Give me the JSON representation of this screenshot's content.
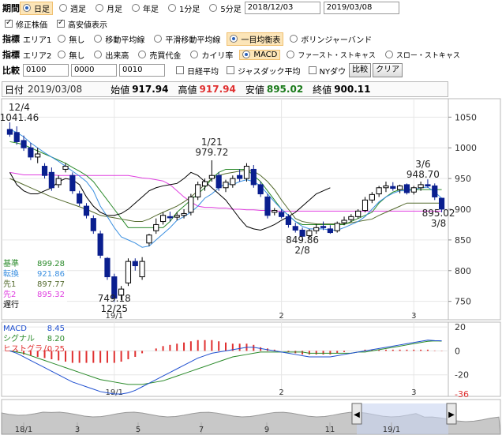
{
  "toolbar": {
    "period": {
      "label": "期間",
      "options": [
        "日足",
        "週足",
        "月足",
        "年足",
        "1分足",
        "5分足"
      ],
      "selected": "日足",
      "date_from": "2018/12/03",
      "date_to": "2019/03/08"
    },
    "checks": [
      {
        "label": "修正株価",
        "checked": true
      },
      {
        "label": "高安値表示",
        "checked": true
      }
    ],
    "indicator1": {
      "label": "指標",
      "sub": "エリア1",
      "options": [
        "無し",
        "移動平均線",
        "平滑移動平均線",
        "一目均衡表",
        "ボリンジャーバンド"
      ],
      "selected": "一目均衡表"
    },
    "indicator2": {
      "label": "指標",
      "sub": "エリア2",
      "options": [
        "無し",
        "出来高",
        "売買代金",
        "カイリ率",
        "MACD",
        "ファースト・ストキャス",
        "スロー・ストキャス"
      ],
      "selected": "MACD"
    },
    "compare": {
      "label": "比較",
      "inputs": [
        "0100",
        "0000",
        "0010"
      ],
      "checks": [
        "日経平均",
        "ジャスダック平均",
        "NYダウ"
      ],
      "compare_button": "比較",
      "clear_button": "クリア"
    }
  },
  "info_bar": {
    "date_label": "日付",
    "date": "2019/03/08",
    "open_label": "始値",
    "open": "917.94",
    "high_label": "高値",
    "high": "917.94",
    "low_label": "安値",
    "low": "895.02",
    "close_label": "終値",
    "close": "900.11"
  },
  "colors": {
    "candle_up": "#000000",
    "candle_down": "#0a1f8f",
    "tenkan": "#3a8fe0",
    "kijun": "#2a8a2a",
    "senko1": "#556b2f",
    "senko2": "#e040e0",
    "chikou": "#000000",
    "macd": "#2050d0",
    "signal": "#2a8a2a",
    "histogram": "#e03030",
    "high_price": "#e03030",
    "low_price": "#1a7a1a"
  },
  "chart_data": [
    {
      "type": "candlestick",
      "title": "",
      "y_ticks": [
        750,
        800,
        850,
        900,
        950,
        1000,
        1050
      ],
      "ylim": [
        720,
        1080
      ],
      "x_ticks": [
        "19/1",
        "2",
        "3"
      ],
      "candles": [
        {
          "o": 1030,
          "h": 1041.46,
          "l": 1018,
          "c": 1022
        },
        {
          "o": 1025,
          "h": 1035,
          "l": 1005,
          "c": 1010
        },
        {
          "o": 1012,
          "h": 1020,
          "l": 995,
          "c": 1000
        },
        {
          "o": 1000,
          "h": 1008,
          "l": 980,
          "c": 985
        },
        {
          "o": 985,
          "h": 1000,
          "l": 975,
          "c": 990
        },
        {
          "o": 970,
          "h": 975,
          "l": 950,
          "c": 955
        },
        {
          "o": 960,
          "h": 968,
          "l": 930,
          "c": 935
        },
        {
          "o": 940,
          "h": 955,
          "l": 935,
          "c": 950
        },
        {
          "o": 965,
          "h": 975,
          "l": 960,
          "c": 970
        },
        {
          "o": 955,
          "h": 960,
          "l": 925,
          "c": 930
        },
        {
          "o": 925,
          "h": 930,
          "l": 905,
          "c": 910
        },
        {
          "o": 905,
          "h": 910,
          "l": 885,
          "c": 890
        },
        {
          "o": 885,
          "h": 890,
          "l": 860,
          "c": 865
        },
        {
          "o": 860,
          "h": 865,
          "l": 820,
          "c": 825
        },
        {
          "o": 820,
          "h": 822,
          "l": 785,
          "c": 790
        },
        {
          "o": 790,
          "h": 795,
          "l": 749.18,
          "c": 755
        },
        {
          "o": 760,
          "h": 775,
          "l": 752,
          "c": 770
        },
        {
          "o": 780,
          "h": 820,
          "l": 775,
          "c": 815
        },
        {
          "o": 815,
          "h": 820,
          "l": 800,
          "c": 808
        },
        {
          "o": 790,
          "h": 822,
          "l": 785,
          "c": 815
        },
        {
          "o": 845,
          "h": 860,
          "l": 840,
          "c": 858
        },
        {
          "o": 865,
          "h": 885,
          "l": 860,
          "c": 875
        },
        {
          "o": 880,
          "h": 895,
          "l": 875,
          "c": 890
        },
        {
          "o": 888,
          "h": 896,
          "l": 880,
          "c": 886
        },
        {
          "o": 887,
          "h": 895,
          "l": 882,
          "c": 890
        },
        {
          "o": 890,
          "h": 900,
          "l": 885,
          "c": 893
        },
        {
          "o": 895,
          "h": 925,
          "l": 890,
          "c": 920
        },
        {
          "o": 920,
          "h": 945,
          "l": 915,
          "c": 940
        },
        {
          "o": 938,
          "h": 950,
          "l": 930,
          "c": 945
        },
        {
          "o": 950,
          "h": 979.72,
          "l": 945,
          "c": 955
        },
        {
          "o": 955,
          "h": 960,
          "l": 930,
          "c": 935
        },
        {
          "o": 935,
          "h": 948,
          "l": 928,
          "c": 944
        },
        {
          "o": 940,
          "h": 955,
          "l": 935,
          "c": 950
        },
        {
          "o": 955,
          "h": 965,
          "l": 945,
          "c": 950
        },
        {
          "o": 950,
          "h": 975,
          "l": 945,
          "c": 970
        },
        {
          "o": 965,
          "h": 972,
          "l": 935,
          "c": 940
        },
        {
          "o": 940,
          "h": 945,
          "l": 920,
          "c": 925
        },
        {
          "o": 920,
          "h": 925,
          "l": 885,
          "c": 890
        },
        {
          "o": 895,
          "h": 902,
          "l": 890,
          "c": 898
        },
        {
          "o": 895,
          "h": 900,
          "l": 885,
          "c": 888
        },
        {
          "o": 888,
          "h": 892,
          "l": 870,
          "c": 875
        },
        {
          "o": 872,
          "h": 878,
          "l": 862,
          "c": 866
        },
        {
          "o": 866,
          "h": 870,
          "l": 849.86,
          "c": 856
        },
        {
          "o": 857,
          "h": 868,
          "l": 853,
          "c": 865
        },
        {
          "o": 865,
          "h": 876,
          "l": 860,
          "c": 870
        },
        {
          "o": 872,
          "h": 880,
          "l": 866,
          "c": 870
        },
        {
          "o": 868,
          "h": 874,
          "l": 860,
          "c": 862
        },
        {
          "o": 865,
          "h": 880,
          "l": 862,
          "c": 877
        },
        {
          "o": 878,
          "h": 888,
          "l": 874,
          "c": 882
        },
        {
          "o": 883,
          "h": 892,
          "l": 879,
          "c": 888
        },
        {
          "o": 888,
          "h": 900,
          "l": 885,
          "c": 897
        },
        {
          "o": 898,
          "h": 920,
          "l": 895,
          "c": 915
        },
        {
          "o": 915,
          "h": 928,
          "l": 910,
          "c": 924
        },
        {
          "o": 925,
          "h": 938,
          "l": 920,
          "c": 935
        },
        {
          "o": 935,
          "h": 945,
          "l": 928,
          "c": 938
        },
        {
          "o": 937,
          "h": 944,
          "l": 930,
          "c": 934
        },
        {
          "o": 932,
          "h": 940,
          "l": 926,
          "c": 938
        },
        {
          "o": 940,
          "h": 942,
          "l": 924,
          "c": 927
        },
        {
          "o": 928,
          "h": 938,
          "l": 924,
          "c": 935
        },
        {
          "o": 935,
          "h": 945,
          "l": 930,
          "c": 940
        },
        {
          "o": 940,
          "h": 948.7,
          "l": 935,
          "c": 938
        },
        {
          "o": 938,
          "h": 942,
          "l": 915,
          "c": 920
        },
        {
          "o": 917.94,
          "h": 917.94,
          "l": 895.02,
          "c": 900.11
        }
      ],
      "tenkan": [
        1030,
        1025,
        1018,
        1008,
        1000,
        992,
        985,
        978,
        970,
        962,
        954,
        945,
        930,
        905,
        888,
        870,
        855,
        850,
        845,
        838,
        840,
        850,
        860,
        870,
        882,
        888,
        895,
        905,
        918,
        925,
        935,
        942,
        940,
        945,
        948,
        945,
        938,
        925,
        912,
        900,
        890,
        880,
        872,
        868,
        868,
        868,
        866,
        866,
        870,
        875,
        880,
        888,
        900,
        912,
        920,
        926,
        930,
        930,
        932,
        935,
        936,
        928,
        918
      ],
      "kijun": [
        1010,
        1008,
        1005,
        1000,
        995,
        990,
        985,
        980,
        975,
        968,
        962,
        955,
        945,
        930,
        915,
        900,
        885,
        870,
        870,
        870,
        870,
        870,
        870,
        880,
        895,
        905,
        915,
        925,
        935,
        950,
        960,
        965,
        965,
        965,
        965,
        955,
        945,
        930,
        915,
        900,
        890,
        880,
        875,
        875,
        875,
        875,
        875,
        875,
        875,
        880,
        885,
        890,
        895,
        910,
        920,
        928,
        932,
        932,
        932,
        932,
        932,
        932,
        932
      ],
      "senko1": [
        950,
        945,
        940,
        935,
        930,
        925,
        920,
        916,
        912,
        908,
        904,
        900,
        895,
        890,
        888,
        886,
        884,
        882,
        880,
        880,
        884,
        890,
        895,
        900,
        905,
        912,
        920,
        930,
        940,
        950,
        955,
        958,
        960,
        962,
        964,
        962,
        955,
        945,
        932,
        915,
        900,
        885,
        880,
        878,
        876,
        876,
        876,
        876,
        876,
        878,
        880,
        882,
        884,
        890,
        895,
        900,
        905,
        910,
        910,
        910,
        910,
        910,
        910
      ],
      "senko2": [
        960,
        958,
        956,
        956,
        956,
        956,
        956,
        955,
        955,
        955,
        955,
        955,
        955,
        955,
        955,
        955,
        955,
        955,
        953,
        951,
        950,
        948,
        946,
        940,
        930,
        920,
        912,
        905,
        903,
        903,
        902,
        902,
        900,
        900,
        899,
        899,
        898,
        898,
        897,
        897,
        897,
        897,
        897,
        897,
        897,
        897,
        897,
        897,
        897,
        897,
        897,
        897,
        897,
        897,
        897,
        897,
        897,
        897,
        897,
        897,
        897,
        897,
        897
      ],
      "chikou": [
        960,
        940,
        930,
        925,
        925,
        930,
        935,
        945,
        950,
        948,
        940,
        920,
        905,
        895,
        890,
        890,
        893,
        900,
        910,
        920,
        930,
        935,
        938,
        940,
        942,
        950,
        960,
        955,
        945,
        935,
        925,
        915,
        900,
        885,
        872,
        868,
        866,
        870,
        875,
        882,
        888,
        895,
        905,
        915,
        925,
        930,
        935
      ],
      "annotations": {
        "high_start": {
          "date": "12/4",
          "value": "1041.46"
        },
        "high_mid": {
          "date": "1/21",
          "value": "979.72"
        },
        "high_end": {
          "date": "3/6",
          "value": "948.70"
        },
        "low_dec": {
          "value": "749.18",
          "date": "12/25"
        },
        "low_feb": {
          "value": "849.86",
          "date": "2/8"
        },
        "low_end": {
          "value": "895.02",
          "date": "3/8"
        }
      },
      "legend": [
        {
          "label": "基準",
          "value": "899.28"
        },
        {
          "label": "転換",
          "value": "921.86"
        },
        {
          "label": "先1",
          "value": "897.77"
        },
        {
          "label": "先2",
          "value": "895.32"
        },
        {
          "label": "遅行",
          "value": ""
        }
      ]
    },
    {
      "type": "line",
      "y_ticks": [
        "20",
        "0",
        "-20"
      ],
      "y_extreme": "-36",
      "ylim": [
        -38,
        24
      ],
      "x_ticks": [
        "19/1",
        "2",
        "3"
      ],
      "legend": [
        {
          "label": "MACD",
          "value": "8.45"
        },
        {
          "label": "シグナル",
          "value": "8.20"
        },
        {
          "label": "ヒストグラム",
          "value": "0.25"
        }
      ],
      "macd": [
        0,
        -2,
        -5,
        -8,
        -11,
        -14,
        -17,
        -20,
        -23,
        -26,
        -28,
        -30,
        -32,
        -34,
        -35,
        -36,
        -36,
        -35,
        -33,
        -30,
        -27,
        -24,
        -21,
        -18,
        -15,
        -12,
        -9,
        -6,
        -4,
        -2,
        -1,
        0,
        1,
        2,
        3,
        3,
        2,
        1,
        0,
        -1,
        -2,
        -3,
        -4,
        -5,
        -5,
        -5,
        -5,
        -4,
        -3,
        -2,
        -1,
        0,
        1,
        2,
        3,
        4,
        5,
        6,
        7,
        8,
        9,
        8.6,
        8.45
      ],
      "signal": [
        0,
        -1,
        -2,
        -4,
        -6,
        -8,
        -10,
        -12,
        -14,
        -16,
        -18,
        -20,
        -22,
        -24,
        -25,
        -26,
        -27,
        -28,
        -28,
        -28,
        -27,
        -26,
        -25,
        -23,
        -21,
        -19,
        -17,
        -15,
        -13,
        -11,
        -9,
        -7,
        -5,
        -4,
        -3,
        -2,
        -1,
        -1,
        -1,
        -1,
        -1,
        -1,
        -1,
        -2,
        -2,
        -2,
        -2,
        -2,
        -2,
        -2,
        -1,
        -1,
        0,
        1,
        2,
        3,
        4,
        5,
        6,
        7,
        8,
        8.3,
        8.2
      ],
      "histogram": [
        0,
        -1,
        -3,
        -4,
        -5,
        -6,
        -7,
        -8,
        -9,
        -10,
        -10,
        -10,
        -10,
        -10,
        -10,
        -10,
        -9,
        -7,
        -5,
        -2,
        0,
        2,
        4,
        5,
        6,
        7,
        8,
        9,
        9,
        9,
        8,
        7,
        6,
        6,
        6,
        5,
        3,
        2,
        1,
        0,
        -1,
        -2,
        -3,
        -3,
        -3,
        -3,
        -3,
        -2,
        -1,
        0,
        0,
        1,
        1,
        1,
        1,
        1,
        1,
        1,
        1,
        1,
        1,
        0.3,
        0.25
      ]
    },
    {
      "type": "area",
      "role": "navigator",
      "x_ticks": [
        "18/1",
        "3",
        "5",
        "7",
        "9",
        "11",
        "19/1"
      ]
    }
  ]
}
